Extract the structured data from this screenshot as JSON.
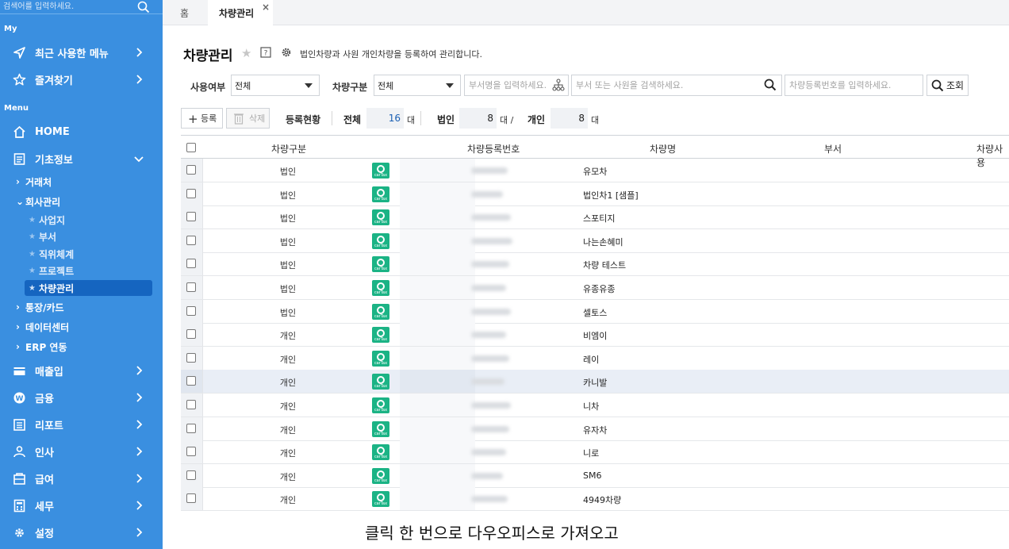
{
  "sidebar": {
    "search_placeholder": "검색어를 입력하세요.",
    "my_label": "My",
    "recent_label": "최근 사용한 메뉴",
    "favorites_label": "즐겨찾기",
    "menu_label": "Menu",
    "home_label": "HOME",
    "basic_label": "기초정보",
    "sub": {
      "clients": "거래처",
      "company": "회사관리",
      "bank": "통장/카드",
      "datacenter": "데이터센터",
      "erp": "ERP 연동"
    },
    "leaves": {
      "site": "사업지",
      "dept": "부서",
      "position": "직위체계",
      "project": "프로젝트",
      "vehicle": "차량관리"
    },
    "menus": {
      "sales": "매출입",
      "finance": "금융",
      "report": "리포트",
      "hr": "인사",
      "payroll": "급여",
      "tax": "세무",
      "settings": "설정"
    }
  },
  "tabs": {
    "home": "홈",
    "active": "차량관리",
    "close": "×"
  },
  "page": {
    "title": "차량관리",
    "description": "법인차량과 사원 개인차량을 등록하여 관리합니다."
  },
  "filters": {
    "usage_label": "사용여부",
    "usage_value": "전체",
    "type_label": "차량구분",
    "type_value": "전체",
    "dept_placeholder": "부서명을 입력하세요.",
    "search_placeholder": "부서 또는 사원을 검색하세요.",
    "plate_placeholder": "차량등록번호를 입력하세요.",
    "query_label": "조회"
  },
  "toolbar": {
    "add_label": "등록",
    "delete_label": "삭제",
    "status_label": "등록현황",
    "total_label": "전체",
    "total_count": "16",
    "total_unit": "대",
    "corp_label": "법인",
    "corp_count": "8",
    "corp_unit": "대 /",
    "personal_label": "개인",
    "personal_count": "8",
    "personal_unit": "대"
  },
  "table": {
    "headers": {
      "type": "차량구분",
      "plate": "차량등록번호",
      "name": "차량명",
      "dept": "부서",
      "user": "차량사용"
    },
    "logo_text": "carTax",
    "rows": [
      {
        "type": "법인",
        "name": "유모차"
      },
      {
        "type": "법인",
        "name": "법인차1 [샘플]"
      },
      {
        "type": "법인",
        "name": "스포티지"
      },
      {
        "type": "법인",
        "name": "나는손혜미"
      },
      {
        "type": "법인",
        "name": "차량 테스트"
      },
      {
        "type": "법인",
        "name": "유종유종"
      },
      {
        "type": "법인",
        "name": "셀토스"
      },
      {
        "type": "개인",
        "name": "비엠이"
      },
      {
        "type": "개인",
        "name": "레이"
      },
      {
        "type": "개인",
        "name": "카니발"
      },
      {
        "type": "개인",
        "name": "니차"
      },
      {
        "type": "개인",
        "name": "유자차"
      },
      {
        "type": "개인",
        "name": "니로"
      },
      {
        "type": "개인",
        "name": "SM6"
      },
      {
        "type": "개인",
        "name": "4949차량"
      }
    ]
  },
  "caption": "클릭 한 번으로 다우오피스로 가져오고"
}
